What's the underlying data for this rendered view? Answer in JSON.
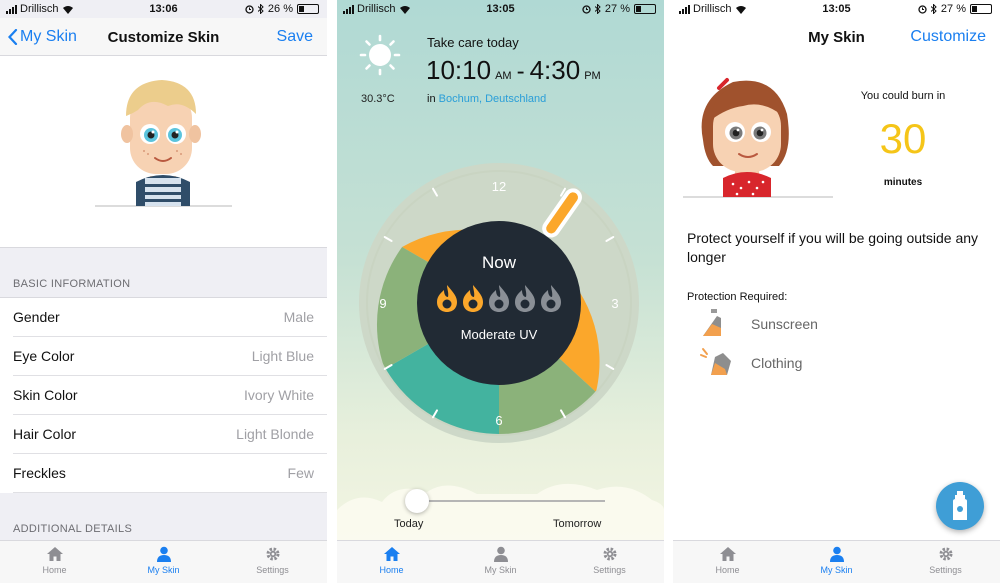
{
  "status": {
    "carrier": "Drillisch",
    "screens": [
      {
        "time": "13:06",
        "battery": "26 %",
        "battery_level": 0.26
      },
      {
        "time": "13:05",
        "battery": "27 %",
        "battery_level": 0.27
      },
      {
        "time": "13:05",
        "battery": "27 %",
        "battery_level": 0.27
      }
    ]
  },
  "tabs": {
    "home": "Home",
    "myskin": "My Skin",
    "settings": "Settings"
  },
  "colors": {
    "accent": "#1a7ff0",
    "orange": "#fba72b",
    "green": "#8bb27a",
    "teal": "#43b39f",
    "dial_center": "#212a34",
    "burn_yellow": "#f5c518"
  },
  "customize": {
    "back_label": "My Skin",
    "title": "Customize Skin",
    "save_label": "Save",
    "basic_header": "BASIC INFORMATION",
    "rows": [
      {
        "label": "Gender",
        "value": "Male"
      },
      {
        "label": "Eye Color",
        "value": "Light Blue"
      },
      {
        "label": "Skin Color",
        "value": "Ivory White"
      },
      {
        "label": "Hair Color",
        "value": "Light Blonde"
      },
      {
        "label": "Freckles",
        "value": "Few"
      }
    ],
    "additional_header": "ADDITIONAL DETAILS"
  },
  "home": {
    "weather_icon": "sun-icon",
    "temperature": "30.3°C",
    "care_label": "Take care today",
    "start_time": "10:10",
    "start_ampm": "AM",
    "end_time": "4:30",
    "end_ampm": "PM",
    "location_prefix": "in",
    "location": "Bochum, Deutschland",
    "dial_numbers": {
      "top": "12",
      "right": "3",
      "bottom": "6",
      "left": "9"
    },
    "now_label": "Now",
    "uv_level": 2,
    "uv_max": 5,
    "uv_text": "Moderate UV",
    "slider_today": "Today",
    "slider_tomorrow": "Tomorrow",
    "slider_position": 0.0
  },
  "myskin": {
    "title": "My Skin",
    "customize_label": "Customize",
    "burn_caption": "You could burn in",
    "burn_value": "30",
    "burn_unit": "minutes",
    "protect_text": "Protect yourself if you will be going outside any longer",
    "protection_header": "Protection Required:",
    "items": [
      {
        "label": "Sunscreen",
        "icon": "sunscreen-icon"
      },
      {
        "label": "Clothing",
        "icon": "clothing-icon"
      }
    ],
    "fab_icon": "sunscreen-bottle-icon"
  }
}
